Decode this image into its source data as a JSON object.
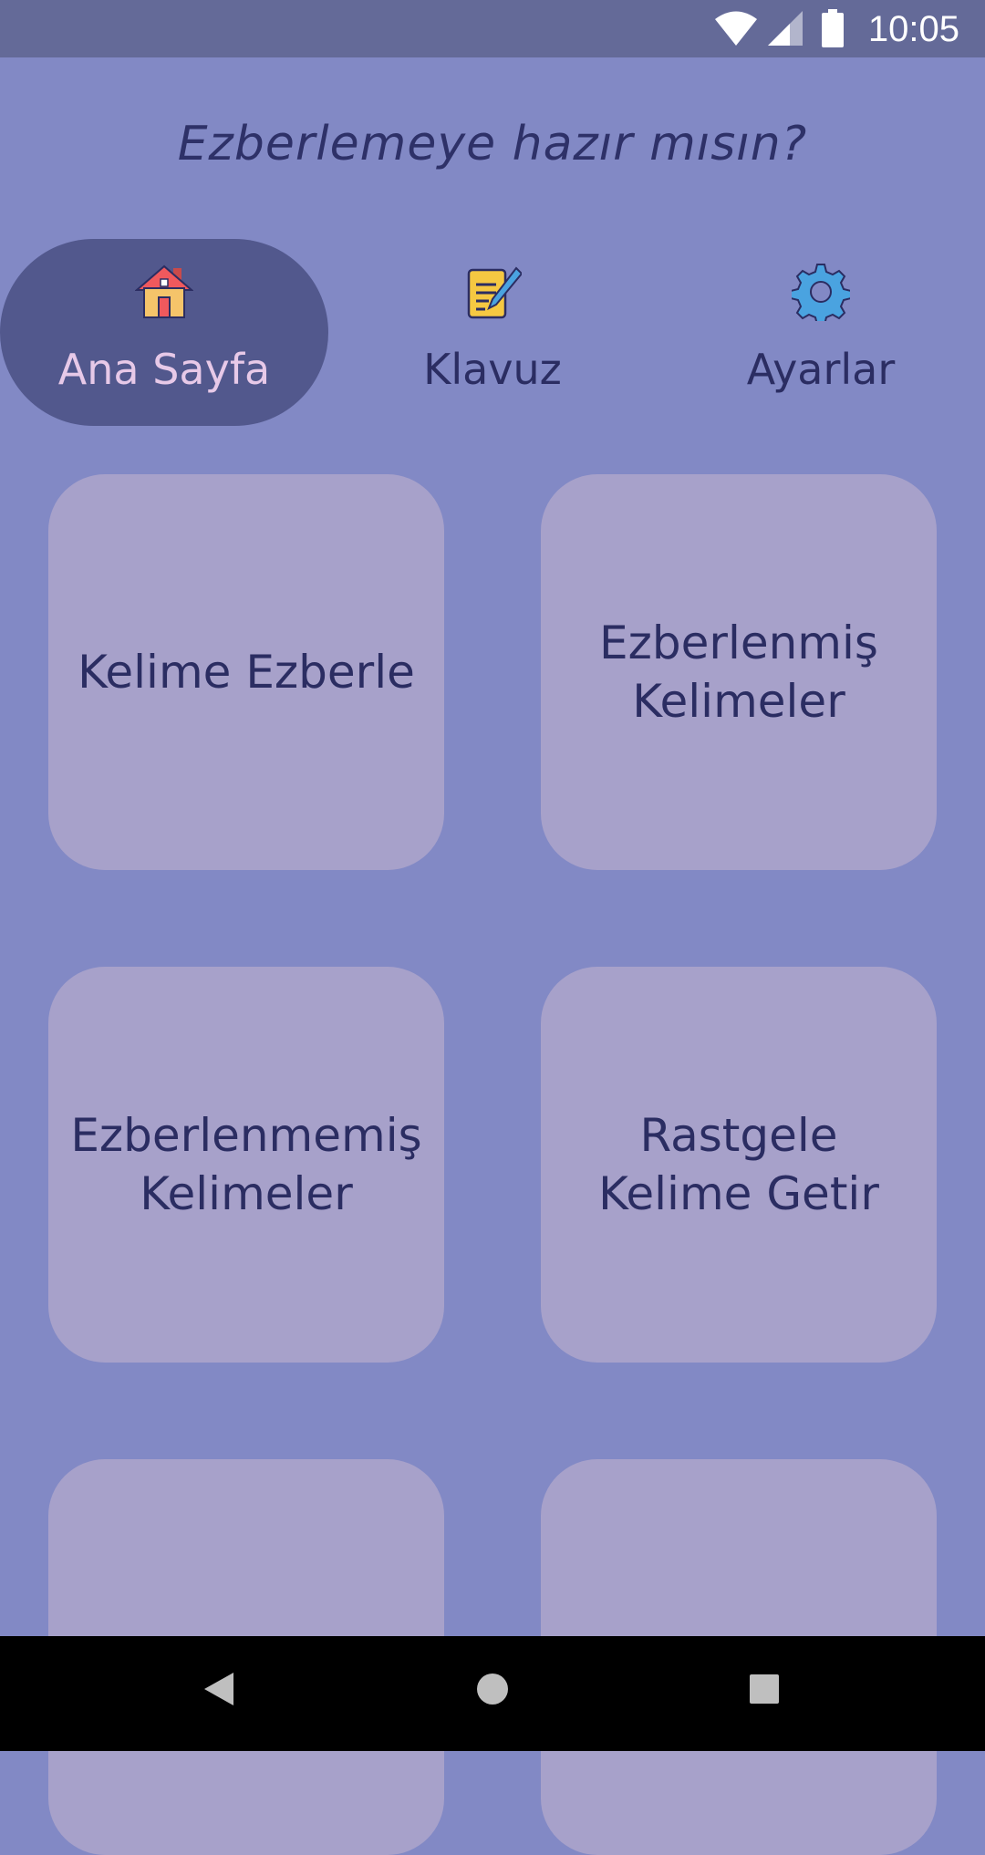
{
  "status_bar": {
    "time": "10:05",
    "icons": [
      "wifi-icon",
      "cellular-signal-icon",
      "battery-icon"
    ]
  },
  "greeting": "Ezberlemeye hazır mısın?",
  "tabs": [
    {
      "label": "Ana Sayfa",
      "icon": "home-icon",
      "active": true
    },
    {
      "label": "Klavuz",
      "icon": "notepad-pen-icon",
      "active": false
    },
    {
      "label": "Ayarlar",
      "icon": "gear-icon",
      "active": false
    }
  ],
  "cards": [
    {
      "label": "Kelime Ezberle"
    },
    {
      "label": "Ezberlenmiş Kelimeler"
    },
    {
      "label": "Ezberlenmemiş Kelimeler"
    },
    {
      "label": "Rastgele Kelime Getir"
    }
  ],
  "nav_bar": {
    "icons": [
      "back-icon",
      "home-circle-icon",
      "recents-icon"
    ]
  },
  "colors": {
    "background": "#8289c5",
    "status_bar": "#646a98",
    "active_tab": "#52588d",
    "card": "#a7a1ca",
    "text": "#2b2d62"
  }
}
